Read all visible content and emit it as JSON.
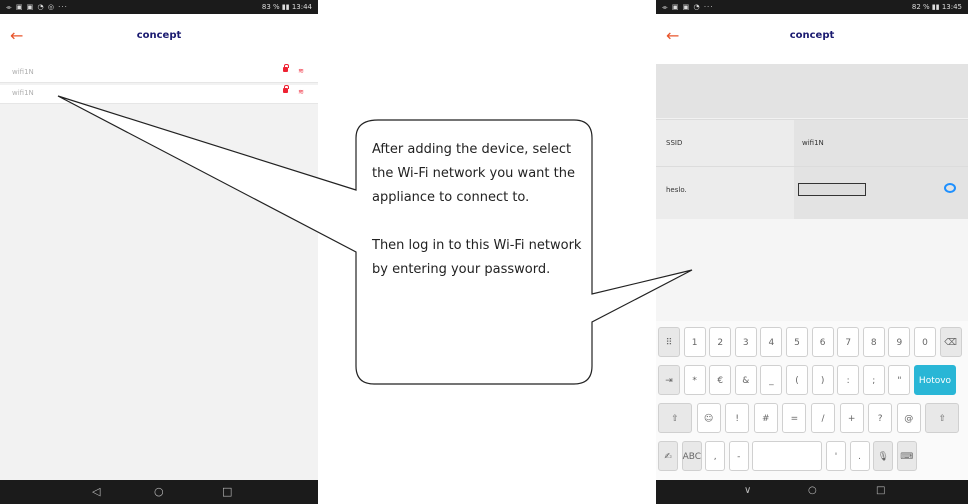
{
  "left_phone": {
    "status_left": "⌯ ▣ ▣ ◔ ◎ ···",
    "status_right": "83 % ▮▮ 13:44",
    "back_icon": "←",
    "app_title": "concept",
    "wifi_networks": [
      {
        "name": "wifi1N"
      },
      {
        "name": "wifi1N"
      }
    ],
    "nav": {
      "back": "◁",
      "home": "○",
      "recent": "□"
    }
  },
  "right_phone": {
    "status_left": "⌯ ▣ ▣ ◔ ···",
    "status_right": "82 % ▮▮ 13:45",
    "back_icon": "←",
    "app_title": "concept",
    "ssid_label": "SSID",
    "ssid_value": "wifi1N",
    "password_label": "heslo.",
    "keyboard_rows": [
      [
        "⠿",
        "1",
        "2",
        "3",
        "4",
        "5",
        "6",
        "7",
        "8",
        "9",
        "0",
        "⌫"
      ],
      [
        "⇥",
        "*",
        "€",
        "&",
        "_",
        "(",
        ")",
        ":",
        ";",
        "\"",
        "Hotovo"
      ],
      [
        "⇧",
        "☺",
        "!",
        "#",
        "=",
        "/",
        "+",
        "?",
        "@",
        "⇧"
      ],
      [
        "✍",
        "ABC",
        ",",
        "-",
        " ",
        "'",
        ".",
        "🎙",
        "⌨"
      ]
    ],
    "nav": {
      "back": "∨",
      "home": "○",
      "recent": "□"
    }
  },
  "callout": {
    "paragraph1": "After adding the device, select the Wi-Fi network you want the appliance to connect to.",
    "paragraph2": "Then log in to this Wi-Fi network by entering your password."
  },
  "colors": {
    "accent": "#e8552c",
    "brand": "#1a1a70",
    "key_teal": "#29b6d6",
    "eye": "#1e90ff"
  }
}
